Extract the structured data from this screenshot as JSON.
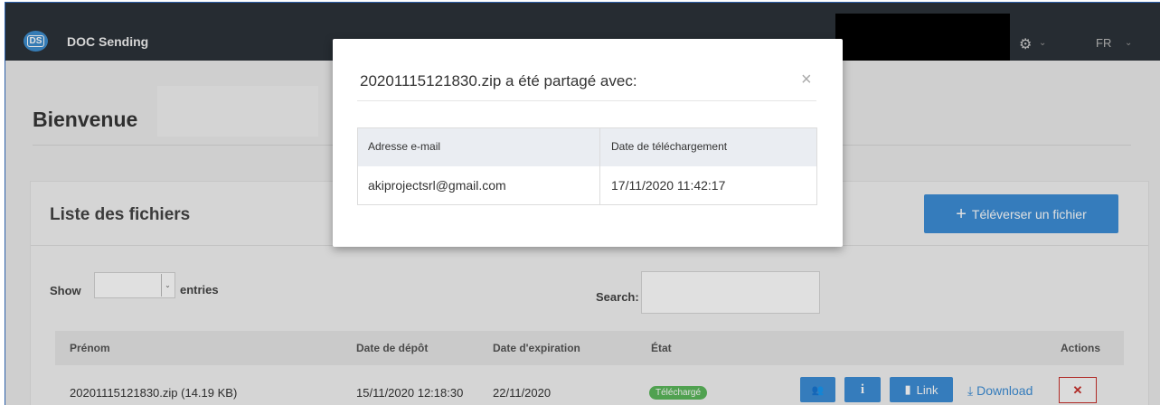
{
  "navbar": {
    "logo_text": "DS",
    "app_name": "DOC Sending",
    "settings_caret": "⌄",
    "language": "FR",
    "language_caret": "⌄"
  },
  "welcome": {
    "title": "Bienvenue"
  },
  "files_panel": {
    "title": "Liste des fichiers",
    "upload_button": "Téléverser un fichier",
    "upload_icon": "+",
    "show_label": "Show",
    "entries_label": "entries",
    "search_label": "Search:",
    "search_value": "",
    "select_caret": "⌄",
    "columns": [
      "Prénom",
      "Date de dépôt",
      "Date d'expiration",
      "État",
      "Actions"
    ],
    "rows": [
      {
        "name": "20201115121830.zip (14.19 KB)",
        "deposit_date": "15/11/2020 12:18:30",
        "expiration_date": "22/11/2020",
        "status": "Téléchargé",
        "actions": {
          "users_icon": "👥",
          "info_icon": "i",
          "link_icon": "▮",
          "link_label": "Link",
          "download_icon": "⤓",
          "download_label": "Download",
          "delete_icon": "✕"
        }
      }
    ]
  },
  "modal": {
    "title": "20201115121830.zip a été partagé avec:",
    "close_icon": "×",
    "columns": [
      "Adresse e-mail",
      "Date de téléchargement"
    ],
    "rows": [
      {
        "email": "akiprojectsrl@gmail.com",
        "download_date": "17/11/2020 11:42:17"
      }
    ]
  },
  "colors": {
    "navbar": "#2c3339",
    "primary": "#3d8ed6",
    "success": "#5cb85c",
    "danger": "#c9302c"
  }
}
